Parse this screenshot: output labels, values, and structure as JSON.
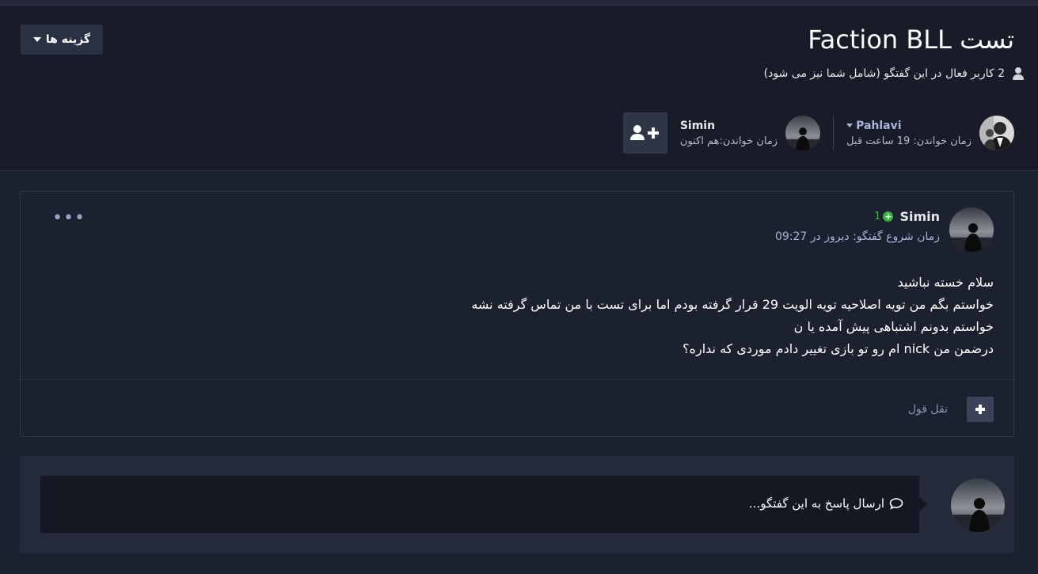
{
  "topic": {
    "title": "تست Faction BLL",
    "options_label": "گزینه ها",
    "active_users_text": "2 کاربر فعال در این گفتگو (شامل شما نیز می شود)"
  },
  "readers": [
    {
      "name": "Pahlavi",
      "time": "زمان خواندن: 19 ساعت قبل"
    },
    {
      "name": "Simin",
      "time": "زمان خواندن:هم اکنون"
    }
  ],
  "post": {
    "author": "Simin",
    "reputation": "1",
    "date": "زمان شروع گفتگو: دیروز در 09:27",
    "menu_label": "•••",
    "lines": [
      "سلام خسته نباشید",
      "خواستم بگم من تویه اصلاحیه تویه الویت 29 قرار گرفته بودم اما برای تست با من تماس گرفته نشه",
      "خواستم بدونم اشتباهی پیش آمده یا ن",
      "درضمن من nick ام رو تو بازی تغییر دادم موردی که نداره؟"
    ],
    "quote_label": "نقل قول"
  },
  "reply": {
    "placeholder": "ارسال پاسخ به این گفتگو..."
  },
  "colors": {
    "background": "#1c2130",
    "header": "#171c28",
    "link": "#a8b4d8",
    "reputation": "#3cb043"
  },
  "icons": {
    "user": "user-icon",
    "caret": "caret-down-icon",
    "add_user": "user-plus-icon",
    "plus": "plus-icon",
    "comment": "comment-icon",
    "ellipsis": "ellipsis-icon"
  }
}
